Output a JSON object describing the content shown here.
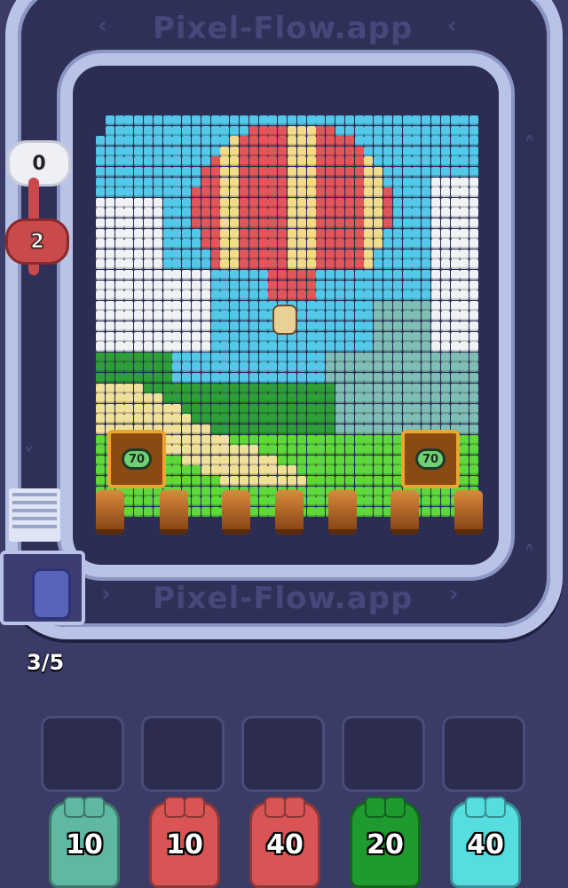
{
  "watermark": "Pixel-Flow.app",
  "left_counters": [
    {
      "value": "0",
      "color": "#eef0f5",
      "kind": "white"
    },
    {
      "value": "2",
      "color": "#c84a4a",
      "kind": "red"
    }
  ],
  "progress": {
    "text": "3/5",
    "current": 3,
    "total": 5
  },
  "crates": [
    {
      "value": "70"
    },
    {
      "value": "70"
    }
  ],
  "slots": [
    {},
    {},
    {},
    {},
    {}
  ],
  "shooters": [
    {
      "value": "10",
      "color": "#5fb8a2"
    },
    {
      "value": "10",
      "color": "#d95555"
    },
    {
      "value": "40",
      "color": "#d95555"
    },
    {
      "value": "20",
      "color": "#1e9a2e"
    },
    {
      "value": "40",
      "color": "#55dde0"
    }
  ],
  "colors": {
    "sky": "#54c8e8",
    "cloud": "#f0f2f5",
    "balloon_red": "#e0565a",
    "balloon_yellow": "#f2dc8a",
    "hill_teal": "#7fbeb4",
    "forest": "#2e9e38",
    "grass": "#5ed83a",
    "path": "#efe09a"
  }
}
